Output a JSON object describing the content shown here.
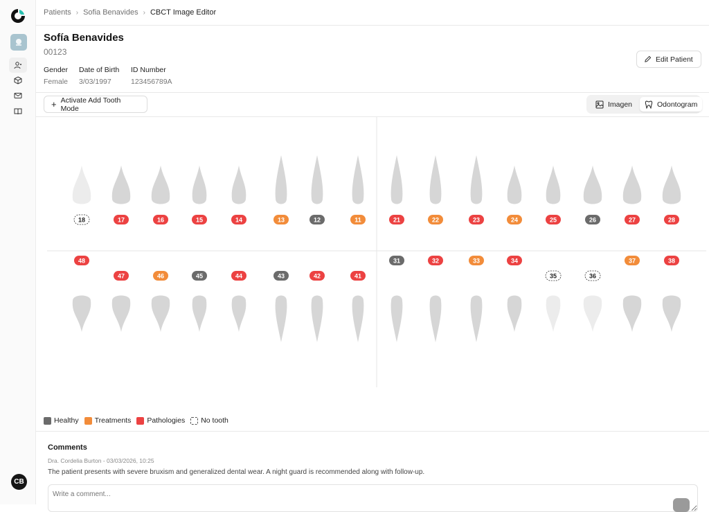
{
  "sidebar": {
    "nav": [
      {
        "icon": "users-icon"
      },
      {
        "icon": "box-icon"
      },
      {
        "icon": "mail-icon"
      },
      {
        "icon": "book-icon"
      }
    ],
    "avatar": "CB"
  },
  "breadcrumb": [
    "Patients",
    "Sofia Benavides",
    "CBCT Image Editor"
  ],
  "patient": {
    "name": "Sofía Benavides",
    "id": "00123",
    "gender_label": "Gender",
    "gender": "Female",
    "dob_label": "Date of Birth",
    "dob": "3/03/1997",
    "idnum_label": "ID Number",
    "idnum": "123456789A"
  },
  "actions": {
    "edit": "Edit Patient",
    "add_tooth": "Activate Add Tooth Mode",
    "view_image": "Imagen",
    "view_odontogram": "Odontogram",
    "active_view": "Odontogram"
  },
  "colors": {
    "healthy": "#6b6b6b",
    "treatments": "#f28c3a",
    "pathologies": "#ec4242",
    "no_tooth": "#ffffff"
  },
  "teeth": {
    "upper": [
      {
        "n": "18",
        "s": "no_tooth"
      },
      {
        "n": "17",
        "s": "pathologies"
      },
      {
        "n": "16",
        "s": "pathologies"
      },
      {
        "n": "15",
        "s": "pathologies"
      },
      {
        "n": "14",
        "s": "pathologies"
      },
      {
        "n": "13",
        "s": "treatments"
      },
      {
        "n": "12",
        "s": "healthy"
      },
      {
        "n": "11",
        "s": "treatments"
      },
      {
        "n": "21",
        "s": "pathologies"
      },
      {
        "n": "22",
        "s": "treatments"
      },
      {
        "n": "23",
        "s": "pathologies"
      },
      {
        "n": "24",
        "s": "treatments"
      },
      {
        "n": "25",
        "s": "pathologies"
      },
      {
        "n": "26",
        "s": "healthy"
      },
      {
        "n": "27",
        "s": "pathologies"
      },
      {
        "n": "28",
        "s": "pathologies"
      }
    ],
    "lower": [
      {
        "n": "48",
        "s": "pathologies"
      },
      {
        "n": "47",
        "s": "pathologies"
      },
      {
        "n": "46",
        "s": "treatments"
      },
      {
        "n": "45",
        "s": "healthy"
      },
      {
        "n": "44",
        "s": "pathologies"
      },
      {
        "n": "43",
        "s": "healthy"
      },
      {
        "n": "42",
        "s": "pathologies"
      },
      {
        "n": "41",
        "s": "pathologies"
      },
      {
        "n": "31",
        "s": "healthy"
      },
      {
        "n": "32",
        "s": "pathologies"
      },
      {
        "n": "33",
        "s": "treatments"
      },
      {
        "n": "34",
        "s": "pathologies"
      },
      {
        "n": "35",
        "s": "no_tooth"
      },
      {
        "n": "36",
        "s": "no_tooth"
      },
      {
        "n": "37",
        "s": "treatments"
      },
      {
        "n": "38",
        "s": "pathologies"
      }
    ]
  },
  "legend": [
    {
      "key": "healthy",
      "label": "Healthy"
    },
    {
      "key": "treatments",
      "label": "Treatments"
    },
    {
      "key": "pathologies",
      "label": "Pathologies"
    },
    {
      "key": "no_tooth",
      "label": "No tooth"
    }
  ],
  "comments": {
    "title": "Comments",
    "meta": "Dra. Cordelia Burton - 03/03/2026, 10:25",
    "text": "The patient presents with severe bruxism and generalized dental wear. A night guard is recommended along with follow-up.",
    "placeholder": "Write a comment..."
  }
}
